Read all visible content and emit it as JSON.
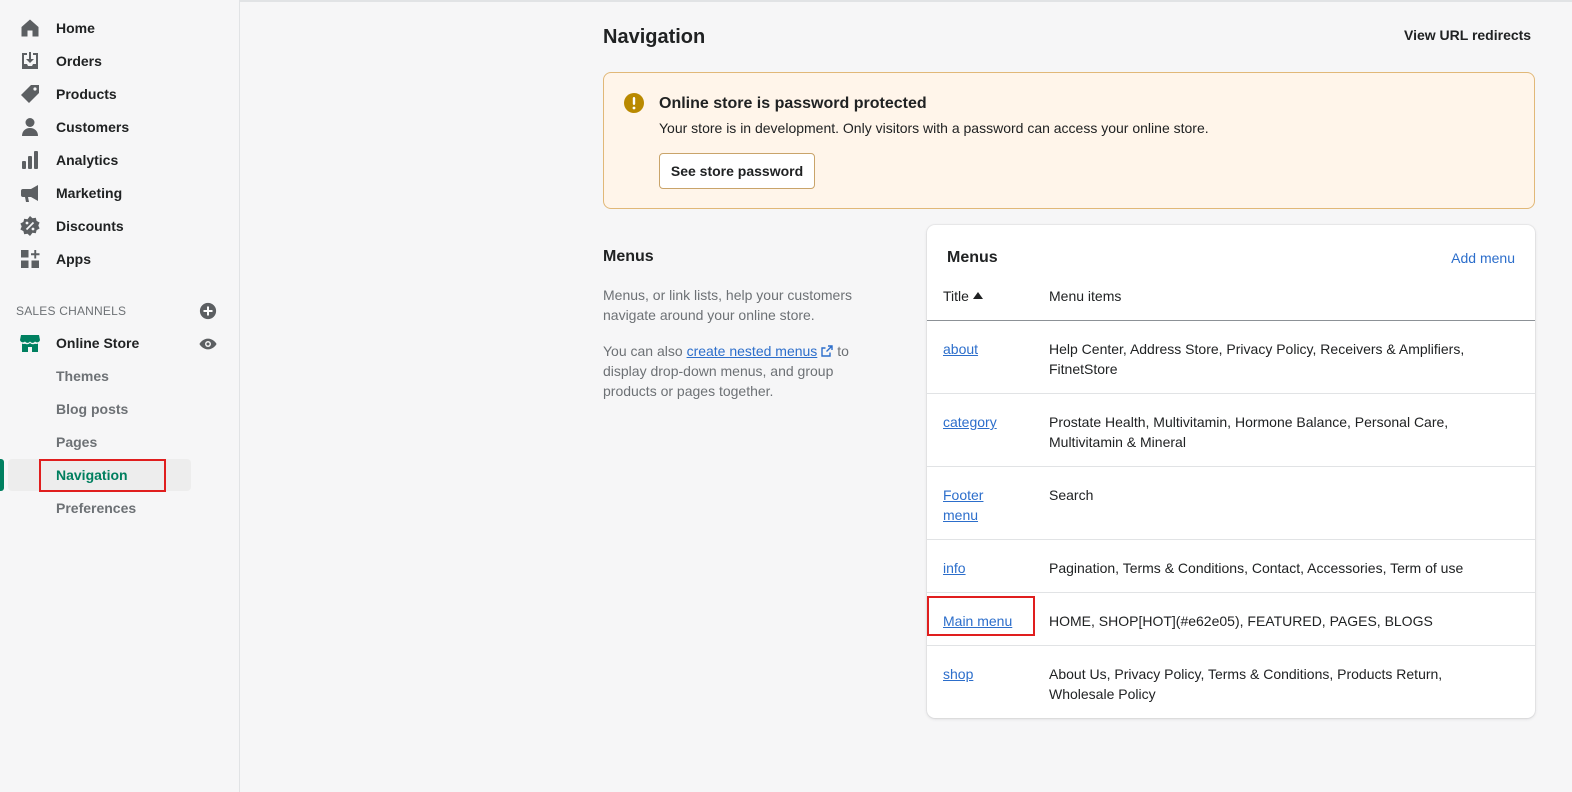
{
  "sidebar": {
    "items": [
      {
        "label": "Home",
        "icon": "home-icon"
      },
      {
        "label": "Orders",
        "icon": "orders-icon"
      },
      {
        "label": "Products",
        "icon": "tag-icon"
      },
      {
        "label": "Customers",
        "icon": "person-icon"
      },
      {
        "label": "Analytics",
        "icon": "bar-chart-icon"
      },
      {
        "label": "Marketing",
        "icon": "megaphone-icon"
      },
      {
        "label": "Discounts",
        "icon": "discount-icon"
      },
      {
        "label": "Apps",
        "icon": "apps-icon"
      }
    ],
    "sales_channels_label": "SALES CHANNELS",
    "online_store": {
      "label": "Online Store",
      "icon": "store-icon"
    },
    "subitems": [
      {
        "label": "Themes"
      },
      {
        "label": "Blog posts"
      },
      {
        "label": "Pages"
      },
      {
        "label": "Navigation",
        "active": true
      },
      {
        "label": "Preferences"
      }
    ]
  },
  "header": {
    "title": "Navigation",
    "redirects_link": "View URL redirects"
  },
  "banner": {
    "title": "Online store is password protected",
    "text": "Your store is in development. Only visitors with a password can access your online store.",
    "button": "See store password"
  },
  "menus_section": {
    "title": "Menus",
    "description": "Menus, or link lists, help your customers navigate around your online store.",
    "desc2_prefix": "You can also ",
    "desc2_link": "create nested menus",
    "desc2_suffix": " to display drop-down menus, and group products or pages together."
  },
  "menus_card": {
    "title": "Menus",
    "add_menu": "Add menu",
    "col_title": "Title",
    "col_items": "Menu items",
    "rows": [
      {
        "title": "about",
        "items": "Help Center, Address Store, Privacy Policy, Receivers & Amplifiers, FitnetStore"
      },
      {
        "title": "category",
        "items": "Prostate Health, Multivitamin, Hormone Balance, Personal Care, Multivitamin & Mineral"
      },
      {
        "title": "Footer menu",
        "items": "Search"
      },
      {
        "title": "info",
        "items": "Pagination, Terms & Conditions, Contact, Accessories, Term of use"
      },
      {
        "title": "Main menu",
        "items": "HOME, SHOP[HOT](#e62e05), FEATURED, PAGES, BLOGS"
      },
      {
        "title": "shop",
        "items": "About Us, Privacy Policy, Terms & Conditions, Products Return, Wholesale Policy"
      }
    ]
  },
  "colors": {
    "accent": "#008060",
    "link": "#2c6ecb",
    "warning_bg": "#fff5ea",
    "highlight_box": "#e01e1e"
  }
}
